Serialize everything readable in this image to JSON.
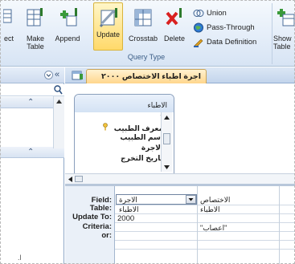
{
  "ribbon": {
    "buttons": {
      "select_partial": "ect",
      "make_table": "Make\nTable",
      "append": "Append",
      "update": "Update",
      "crosstab": "Crosstab",
      "delete": "Delete",
      "show_table_partial": "Show\nTable"
    },
    "small_commands": {
      "union": "Union",
      "pass_through": "Pass-Through",
      "data_definition": "Data Definition"
    },
    "group_label": "Query Type"
  },
  "document": {
    "tab_title": "اجرة اطباء الاختصاص ٢٠٠٠"
  },
  "table_box": {
    "title": "الاطباء",
    "fields": [
      "*",
      "معرف الطبيب",
      "اسم الطبيب",
      "الاجرة",
      "تاريخ التخرج"
    ]
  },
  "grid": {
    "row_labels": {
      "field": "Field:",
      "table": "Table:",
      "update_to": "Update To:",
      "criteria": "Criteria:",
      "or": "or:"
    },
    "columns": [
      {
        "field": "الاجرة",
        "table": "الاطباء",
        "update_to": "2000",
        "criteria": ""
      },
      {
        "field": "الاختصاص",
        "table": "الاطباء",
        "update_to": "",
        "criteria": "\"اعصاب\""
      }
    ]
  },
  "colors": {
    "accent_tab": "#ffd68c",
    "update_highlight": "#ffd96a",
    "ribbon_bg": "#dfe9f6"
  }
}
